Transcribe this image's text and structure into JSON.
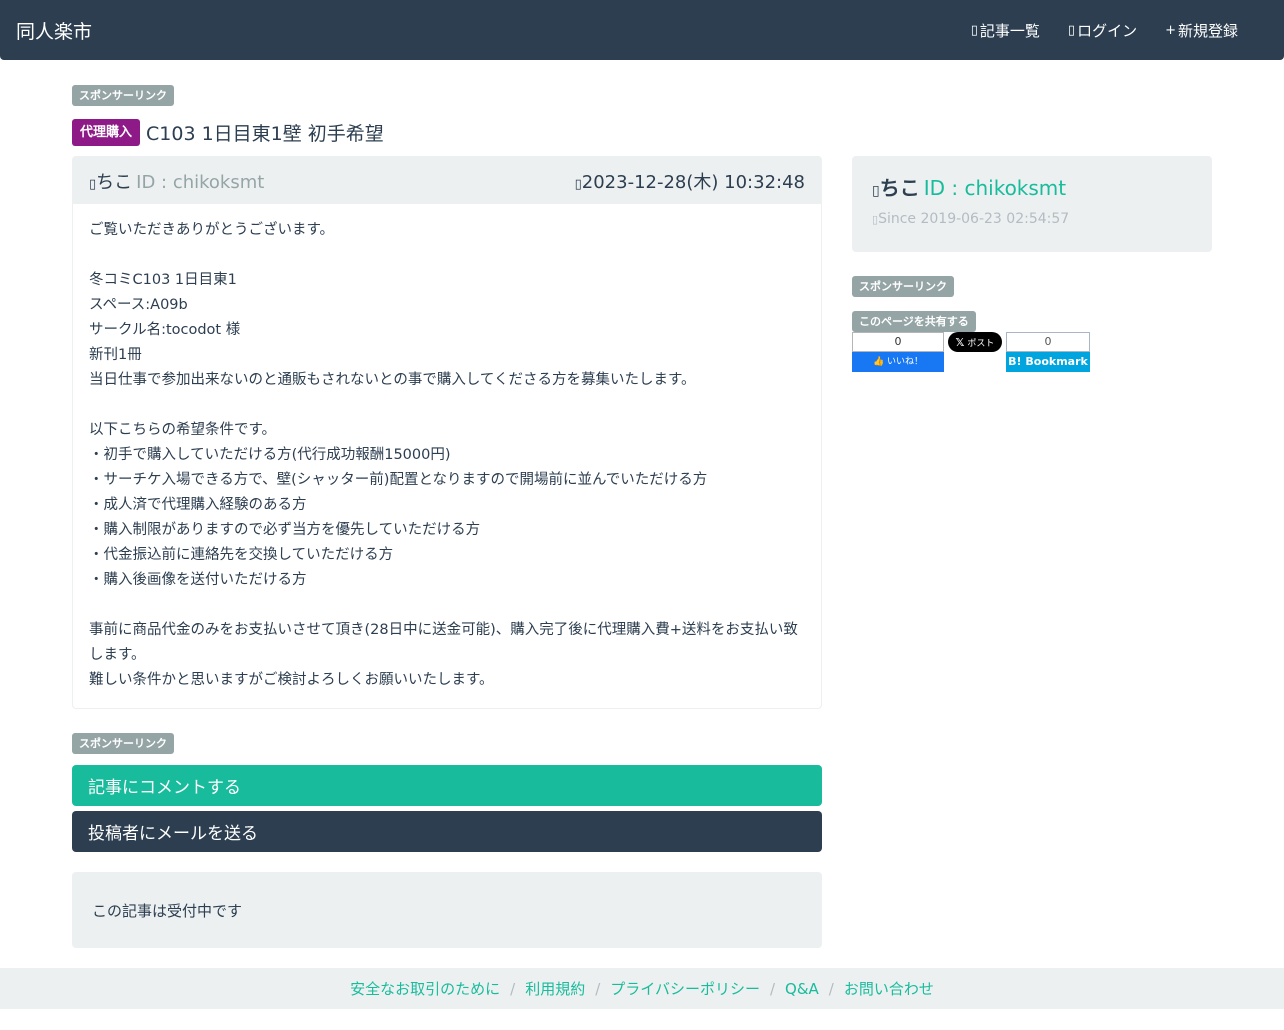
{
  "navbar": {
    "brand": "同人楽市",
    "links": [
      {
        "label": "記事一覧",
        "icon": "list-icon"
      },
      {
        "label": "ログイン",
        "icon": "login-icon"
      },
      {
        "label": "新規登録",
        "icon": "plus-icon",
        "prefix": "+"
      }
    ]
  },
  "sponsor_label": "スポンサーリンク",
  "post": {
    "category": "代理購入",
    "title": "C103 1日目東1壁 初手希望",
    "author_name": "ちこ",
    "author_id": "ID : chikoksmt",
    "date": "2023-12-28(木) 10:32:48",
    "body_lines": [
      "ご覧いただきありがとうございます。",
      "",
      "冬コミC103 1日目東1",
      "スペース:A09b",
      "サークル名:tocodot 様",
      "新刊1冊",
      "当日仕事で参加出来ないのと通販もされないとの事で購入してくださる方を募集いたします。",
      "",
      "以下こちらの希望条件です。",
      "・初手で購入していただける方(代行成功報酬15000円)",
      "・サーチケ入場できる方で、壁(シャッター前)配置となりますので開場前に並んでいただける方",
      "・成人済で代理購入経験のある方",
      "・購入制限がありますので必ず当方を優先していただける方",
      "・代金振込前に連絡先を交換していただける方",
      "・購入後画像を送付いただける方",
      "",
      "事前に商品代金のみをお支払いさせて頂き(28日中に送金可能)、購入完了後に代理購入費+送料をお支払い致します。",
      "難しい条件かと思いますがご検討よろしくお願いいたします。"
    ]
  },
  "actions": {
    "comment_label": "記事にコメントする",
    "mail_label": "投稿者にメールを送る"
  },
  "status_text": "この記事は受付中です",
  "profile": {
    "name": "ちこ",
    "id": "ID : chikoksmt",
    "since": "Since 2019-06-23 02:54:57"
  },
  "share": {
    "label": "このページを共有する",
    "fb_count": "0",
    "fb_label": "いいね！",
    "x_label": "ポスト",
    "hatena_count": "0",
    "hatena_label": "B! Bookmark"
  },
  "footer": {
    "links": [
      "安全なお取引のために",
      "利用規約",
      "プライバシーポリシー",
      "Q&A",
      "お問い合わせ"
    ]
  },
  "colors": {
    "navbar": "#2c3e50",
    "accent": "#18bc9c",
    "category": "#8e1a87",
    "muted": "#95a5a6",
    "well": "#ecf0f1"
  }
}
